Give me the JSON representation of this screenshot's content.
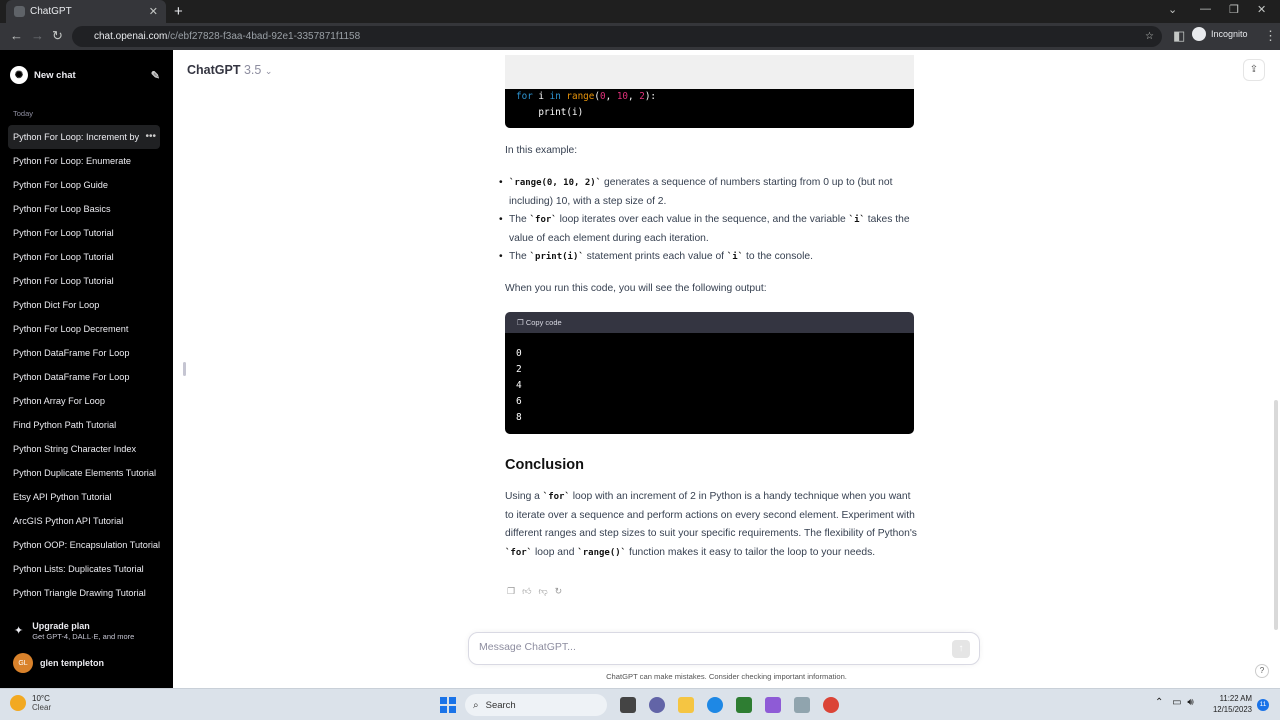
{
  "browser": {
    "tab_title": "ChatGPT",
    "url_host": "chat.openai.com",
    "url_path": "/c/ebf27828-f3aa-4bad-92e1-3357871f1158",
    "profile_label": "Incognito"
  },
  "sidebar": {
    "new_chat": "New chat",
    "section_label": "Today",
    "items": [
      "Python For Loop: Increment by",
      "Python For Loop: Enumerate",
      "Python For Loop Guide",
      "Python For Loop Basics",
      "Python For Loop Tutorial",
      "Python For Loop Tutorial",
      "Python For Loop Tutorial",
      "Python Dict For Loop",
      "Python For Loop Decrement",
      "Python DataFrame For Loop",
      "Python DataFrame For Loop",
      "Python Array For Loop",
      "Find Python Path Tutorial",
      "Python String Character Index",
      "Python Duplicate Elements Tutorial",
      "Etsy API Python Tutorial",
      "ArcGIS Python API Tutorial",
      "Python OOP: Encapsulation Tutorial",
      "Python Lists: Duplicates Tutorial",
      "Python Triangle Drawing Tutorial"
    ],
    "upgrade_title": "Upgrade plan",
    "upgrade_subtitle": "Get GPT-4, DALL·E, and more",
    "user_initials": "GL",
    "user_name": "glen templeton"
  },
  "header": {
    "model_name": "ChatGPT",
    "model_version": "3.5"
  },
  "content": {
    "code1_line1_kw1": "for",
    "code1_line1_var": " i ",
    "code1_line1_kw2": "in",
    "code1_line1_fn": " range",
    "code1_line1_open": "(",
    "code1_line1_n1": "0",
    "code1_line1_sep1": ", ",
    "code1_line1_n2": "10",
    "code1_line1_sep2": ", ",
    "code1_line1_n3": "2",
    "code1_line1_close": "):",
    "code1_line2": "    print(i)",
    "intro": "In this example:",
    "b1_code": "`range(0, 10, 2)`",
    "b1_text": " generates a sequence of numbers starting from 0 up to (but not including) 10, with a step size of 2.",
    "b2_pre": "The ",
    "b2_code1": "`for`",
    "b2_mid": " loop iterates over each value in the sequence, and the variable ",
    "b2_code2": "`i`",
    "b2_post": " takes the value of each element during each iteration.",
    "b3_pre": "The ",
    "b3_code1": "`print(i)`",
    "b3_mid": " statement prints each value of ",
    "b3_code2": "`i`",
    "b3_post": " to the console.",
    "output_intro": "When you run this code, you will see the following output:",
    "copy_code": "Copy code",
    "output_lines": [
      "0",
      "2",
      "4",
      "6",
      "8"
    ],
    "conclusion_heading": "Conclusion",
    "c_pre": "Using a ",
    "c_code1": "`for`",
    "c_mid1": " loop with an increment of 2 in Python is a handy technique when you want to iterate over a sequence and perform actions on every second element. Experiment with different ranges and step sizes to suit your specific requirements. The flexibility of Python's ",
    "c_code2": "`for`",
    "c_mid2": " loop and ",
    "c_code3": "`range()`",
    "c_post": " function makes it easy to tailor the loop to your needs."
  },
  "composer": {
    "placeholder": "Message ChatGPT..."
  },
  "footer": {
    "disclaimer": "ChatGPT can make mistakes. Consider checking important information.",
    "help": "?"
  },
  "taskbar": {
    "temperature": "10°C",
    "weather": "Clear",
    "search": "Search",
    "time": "11:22 AM",
    "date": "12/15/2023",
    "notifications": "11"
  },
  "colors": {
    "sidebar_bg": "#000000",
    "code_keyword": "#2e95d3",
    "code_function": "#e9950c",
    "code_number": "#df3079"
  }
}
